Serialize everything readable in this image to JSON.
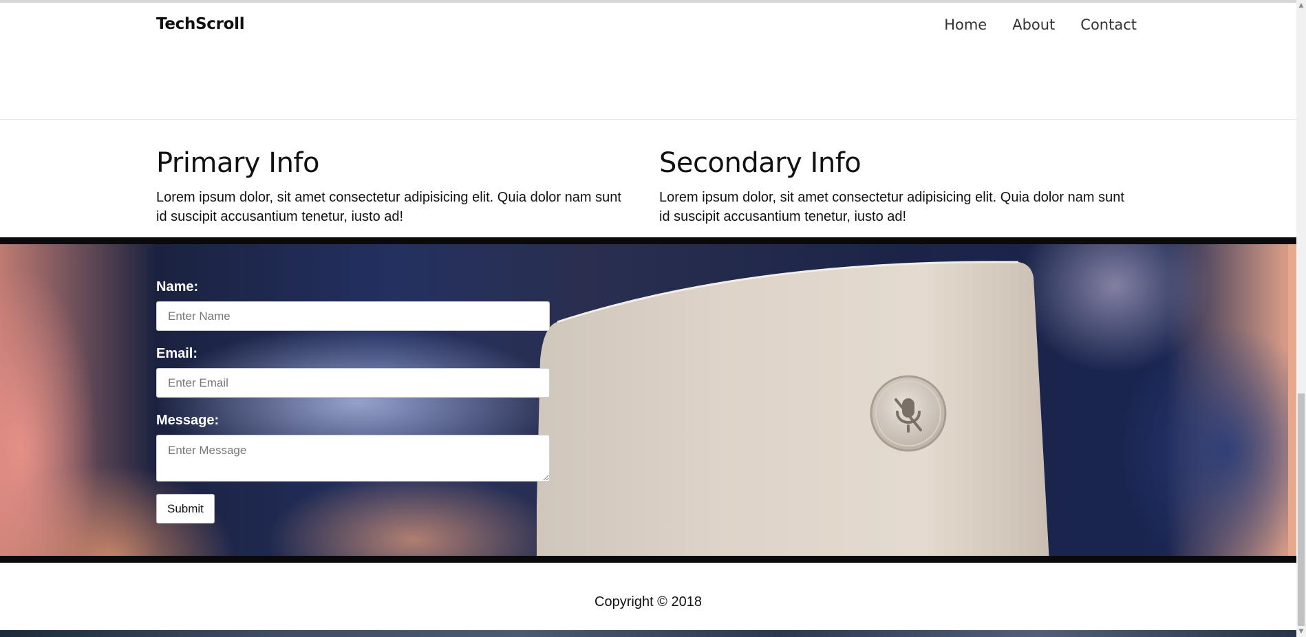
{
  "header": {
    "brand": "TechScroll",
    "nav": [
      "Home",
      "About",
      "Contact"
    ]
  },
  "info": {
    "primary": {
      "title": "Primary Info",
      "text": "Lorem ipsum dolor, sit amet consectetur adipisicing elit. Quia dolor nam sunt id suscipit accusantium tenetur, iusto ad!"
    },
    "secondary": {
      "title": "Secondary Info",
      "text": "Lorem ipsum dolor, sit amet consectetur adipisicing elit. Quia dolor nam sunt id suscipit accusantium tenetur, iusto ad!"
    }
  },
  "form": {
    "name_label": "Name:",
    "name_placeholder": "Enter Name",
    "email_label": "Email:",
    "email_placeholder": "Enter Email",
    "message_label": "Message:",
    "message_placeholder": "Enter Message",
    "submit_label": "Submit"
  },
  "footer": {
    "copyright": "Copyright © 2018"
  },
  "scrollbar": {
    "up_icon": "▲",
    "down_icon": "▼"
  },
  "colors": {
    "band_background": "#0a0a0c",
    "accent_skin": "#e8a88e"
  }
}
